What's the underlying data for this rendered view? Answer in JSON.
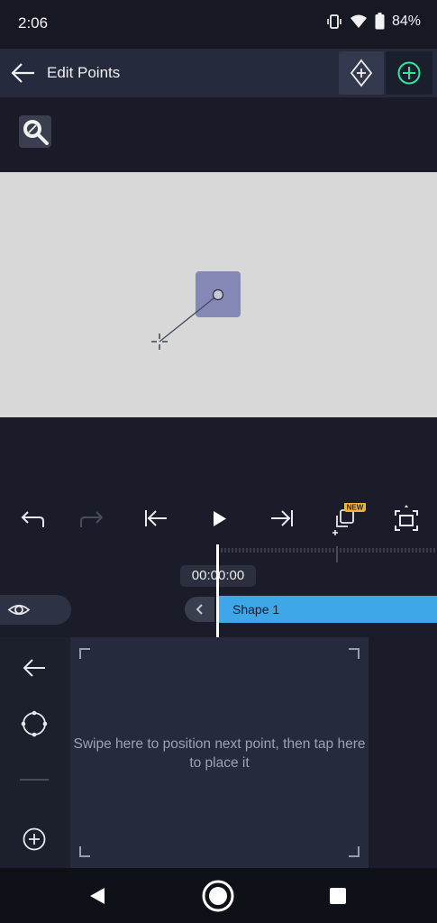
{
  "status_bar": {
    "time": "2:06",
    "battery": "84%",
    "icons": [
      "vibrate-icon",
      "wifi-icon",
      "battery-icon"
    ]
  },
  "header": {
    "title": "Edit Points",
    "back_icon": "arrow-left-icon",
    "keyframe_icon": "keyframe-add-icon",
    "add_icon": "plus-circle-icon",
    "add_color": "#2ee6a0"
  },
  "zoom": {
    "icon": "zoom-fit-icon"
  },
  "canvas": {
    "background": "#d8d8d8",
    "shape_color": "#8588b4"
  },
  "transport": {
    "buttons": [
      "undo-icon",
      "redo-icon",
      "jump-start-icon",
      "play-icon",
      "jump-end-icon",
      "duplicate-icon",
      "fullscreen-icon"
    ],
    "new_badge": "NEW",
    "badge_color": "#f2b531"
  },
  "timeline": {
    "timecode": "00:00:00",
    "clip_label": "Shape 1",
    "clip_color": "#3ea7e8"
  },
  "tools": {
    "items": [
      "arrow-left-icon",
      "path-points-icon",
      "line-thickness-icon",
      "plus-circle-icon"
    ]
  },
  "touch_pad": {
    "hint": "Swipe here to position next point, then tap here to place it"
  },
  "nav": {
    "buttons": [
      "back-triangle-icon",
      "home-circle-icon",
      "recents-square-icon"
    ]
  }
}
